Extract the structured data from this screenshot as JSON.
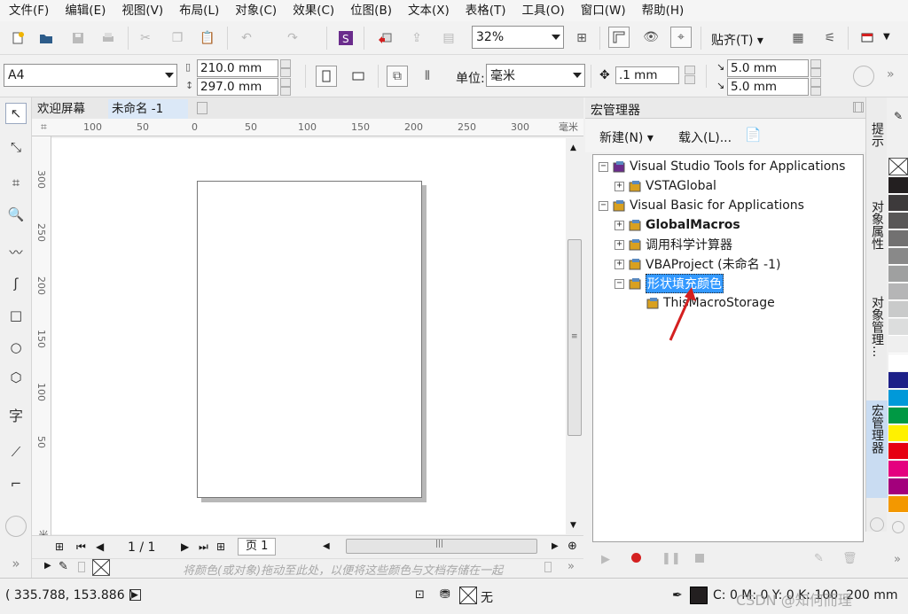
{
  "menus": [
    "文件(F)",
    "编辑(E)",
    "视图(V)",
    "布局(L)",
    "对象(C)",
    "效果(C)",
    "位图(B)",
    "文本(X)",
    "表格(T)",
    "工具(O)",
    "窗口(W)",
    "帮助(H)"
  ],
  "toolbar": {
    "zoom_value": "32%",
    "snap_label": "贴齐(T)"
  },
  "property_bar": {
    "page_size": "A4",
    "width": "210.0 mm",
    "height": "297.0 mm",
    "unit_label": "单位:",
    "unit_value": "毫米",
    "nudge": ".1 mm",
    "dup_x": "5.0 mm",
    "dup_y": "5.0 mm"
  },
  "doc_tabs": [
    "欢迎屏幕",
    "未命名 -1"
  ],
  "ruler": {
    "h_ticks": [
      "100",
      "50",
      "0",
      "50",
      "100",
      "150",
      "200",
      "250",
      "300"
    ],
    "unit": "毫米",
    "v_ticks": [
      "300",
      "250",
      "200",
      "150",
      "100",
      "50"
    ],
    "v_unit": "米"
  },
  "page_nav": {
    "page_count": "1 / 1",
    "page_tab": "页 1"
  },
  "doc_palette_hint": "将颜色(或对象)拖动至此处，以便将这些颜色与文档存储在一起",
  "macro_manager": {
    "title": "宏管理器",
    "new_label": "新建(N)",
    "load_label": "载入(L)...",
    "tree": [
      {
        "label": "Visual Studio Tools for Applications",
        "level": 0,
        "expander": "−"
      },
      {
        "label": "VSTAGlobal",
        "level": 1,
        "expander": "+"
      },
      {
        "label": "Visual Basic for Applications",
        "level": 0,
        "expander": "−"
      },
      {
        "label": "GlobalMacros",
        "level": 1,
        "expander": "+"
      },
      {
        "label": "调用科学计算器",
        "level": 1,
        "expander": "+"
      },
      {
        "label": "VBAProject (未命名 -1)",
        "level": 1,
        "expander": "+"
      },
      {
        "label": "形状填充颜色",
        "level": 1,
        "expander": "−"
      },
      {
        "label": "ThisMacroStorage",
        "level": 2,
        "expander": ""
      }
    ]
  },
  "side_tabs": [
    "提示",
    "对象属性",
    "对象管理...",
    "宏管理器"
  ],
  "palette_colors": [
    "#231f20",
    "#3d3a3b",
    "#595757",
    "#727171",
    "#898989",
    "#9fa0a0",
    "#b5b5b6",
    "#c9caca",
    "#dcdddd",
    "#efefef",
    "#ffffff",
    "#1d2088",
    "#0099d9",
    "#009944",
    "#fff100",
    "#e60012",
    "#e4007f",
    "#a3007c",
    "#f39800"
  ],
  "status": {
    "coords": "( 335.788, 153.886 )",
    "fill_none": "无",
    "color_readout": "C: 0 M: 0 Y: 0 K: 100  .200 mm",
    "watermark": "CSDN @知何而理"
  }
}
